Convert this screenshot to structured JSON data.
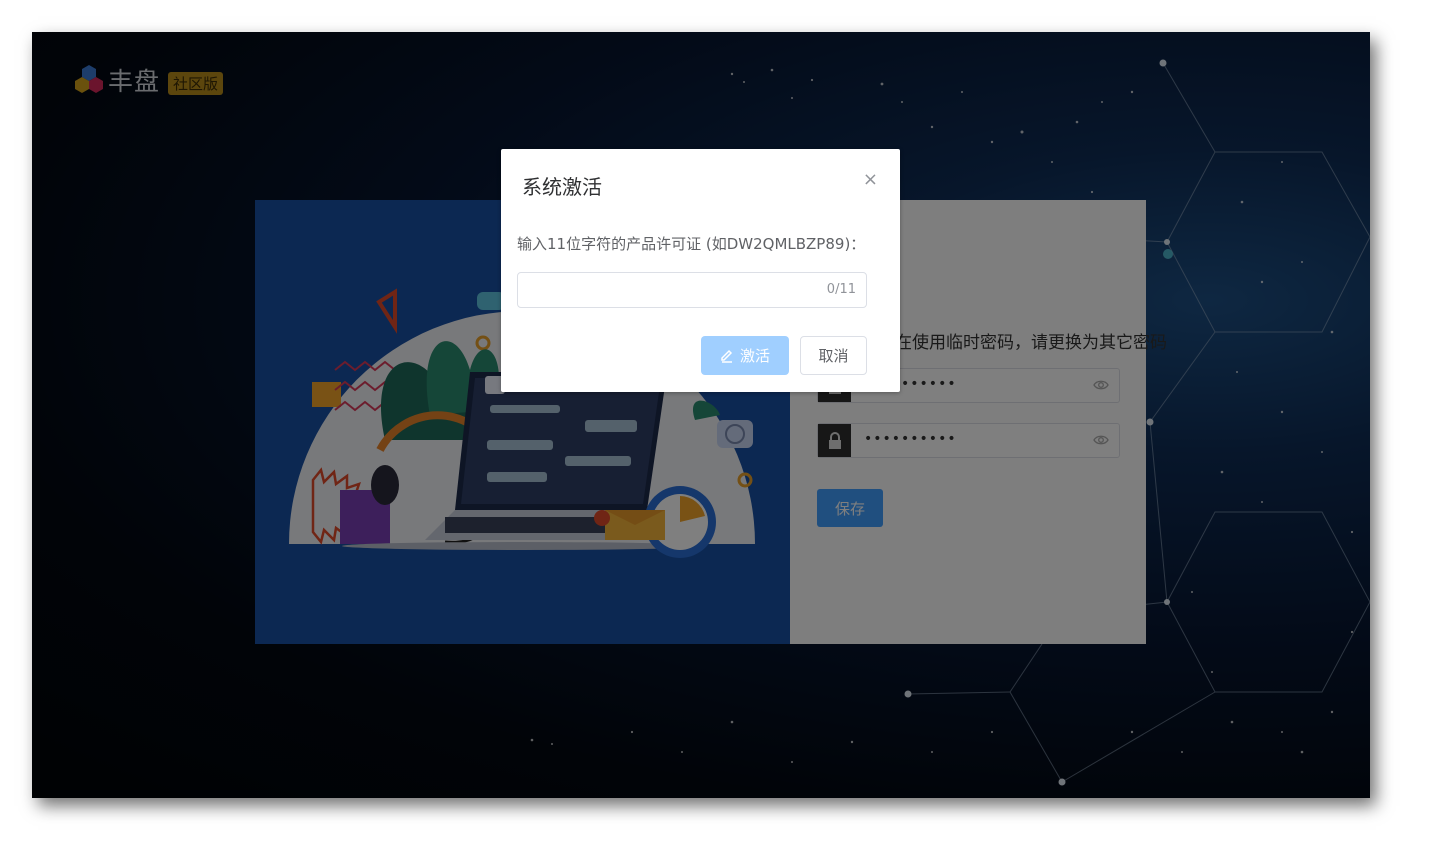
{
  "brand": {
    "name": "丰盘",
    "edition_badge": "社区版"
  },
  "login_card": {
    "notice_text": "正在使用临时密码，请更换为其它密码",
    "password_masked": "••••••••••",
    "confirm_masked": "••••••••••",
    "save_label": "保存"
  },
  "dialog": {
    "title": "系统激活",
    "close_glyph": "×",
    "label": "输入11位字符的产品许可证 (如DW2QMLBZP89)：",
    "input_value": "",
    "counter": "0/11",
    "activate_label": "激活",
    "cancel_label": "取消"
  },
  "colors": {
    "primary": "#409eff",
    "primary_disabled": "#a0cfff",
    "badge": "#b98c1a",
    "illustration_bg": "#1951a5"
  },
  "icons": {
    "close": "close-icon",
    "edit": "edit-icon",
    "lock": "lock-icon",
    "eye": "eye-icon",
    "logo": "hexagon-cubes-icon"
  }
}
